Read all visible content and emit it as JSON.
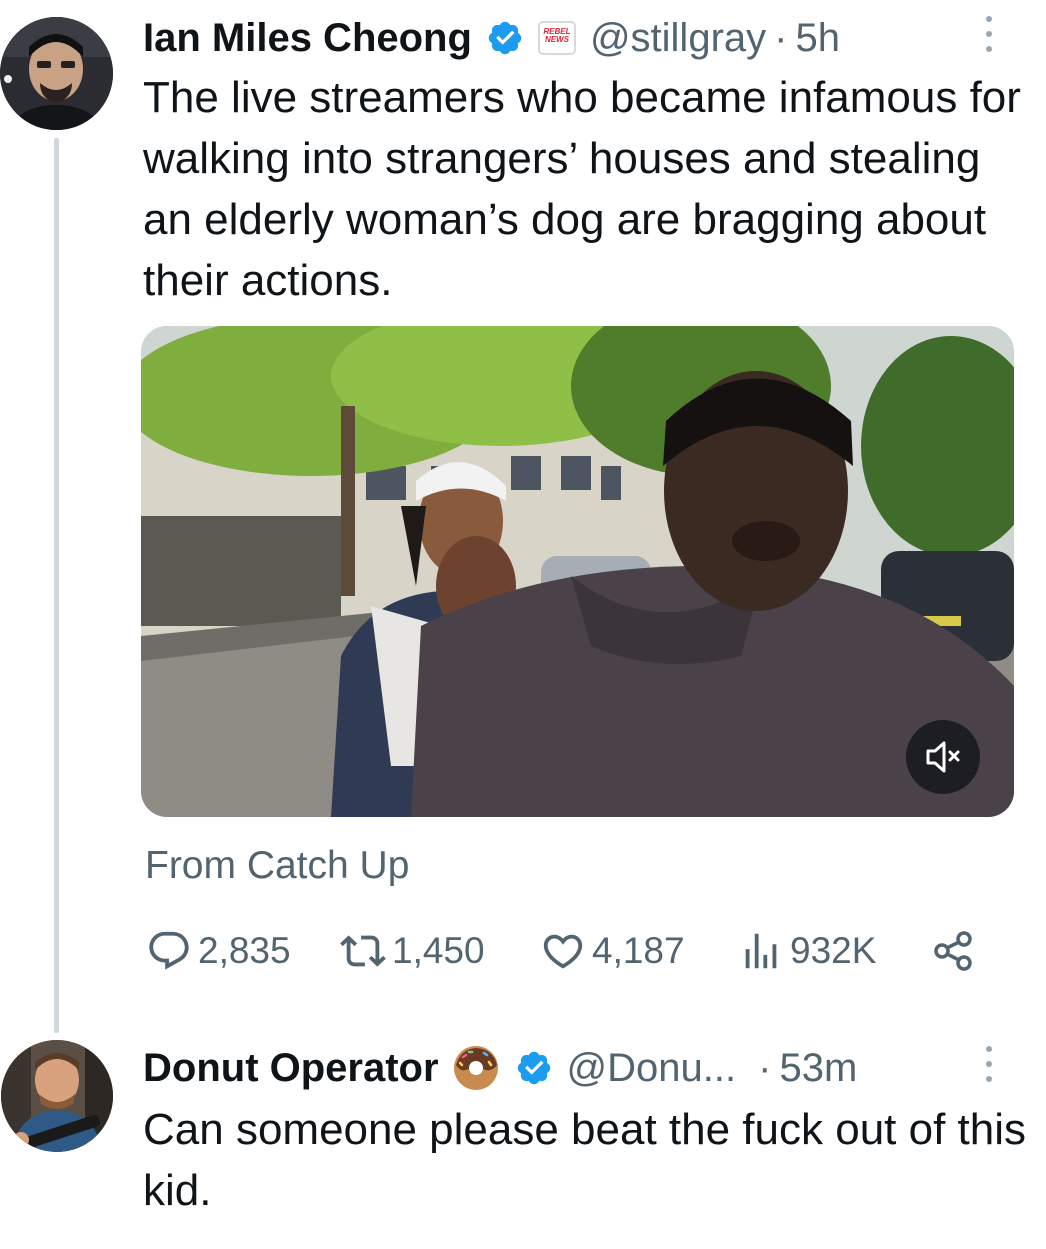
{
  "tweet": {
    "author": {
      "display_name": "Ian Miles Cheong",
      "handle": "@stillgray",
      "verified": true,
      "affiliate_badge": "REBEL NEWS",
      "avatar_icon": "avatar-profile-photo"
    },
    "separator": "·",
    "timestamp": "5h",
    "text": "The live streamers who became infamous for walking into strangers’ houses and stealing an elderly woman’s dog are bragging about their actions.",
    "media": {
      "type": "video",
      "muted": true
    },
    "source": "From Catch Up",
    "stats": {
      "replies": "2,835",
      "retweets": "1,450",
      "likes": "4,187",
      "views": "932K"
    }
  },
  "reply": {
    "author": {
      "display_name": "Donut Operator",
      "name_emoji": "doughnut",
      "handle": "@Donu...",
      "verified": true,
      "avatar_icon": "avatar-profile-photo"
    },
    "separator": "·",
    "timestamp": "53m",
    "text": "Can someone please beat the fuck out of this kid."
  },
  "colors": {
    "text_primary": "#0f1419",
    "text_secondary": "#536471",
    "verified_blue": "#1d9bf0",
    "thread_line": "#cfd9de",
    "badge_red": "#e0243c"
  }
}
